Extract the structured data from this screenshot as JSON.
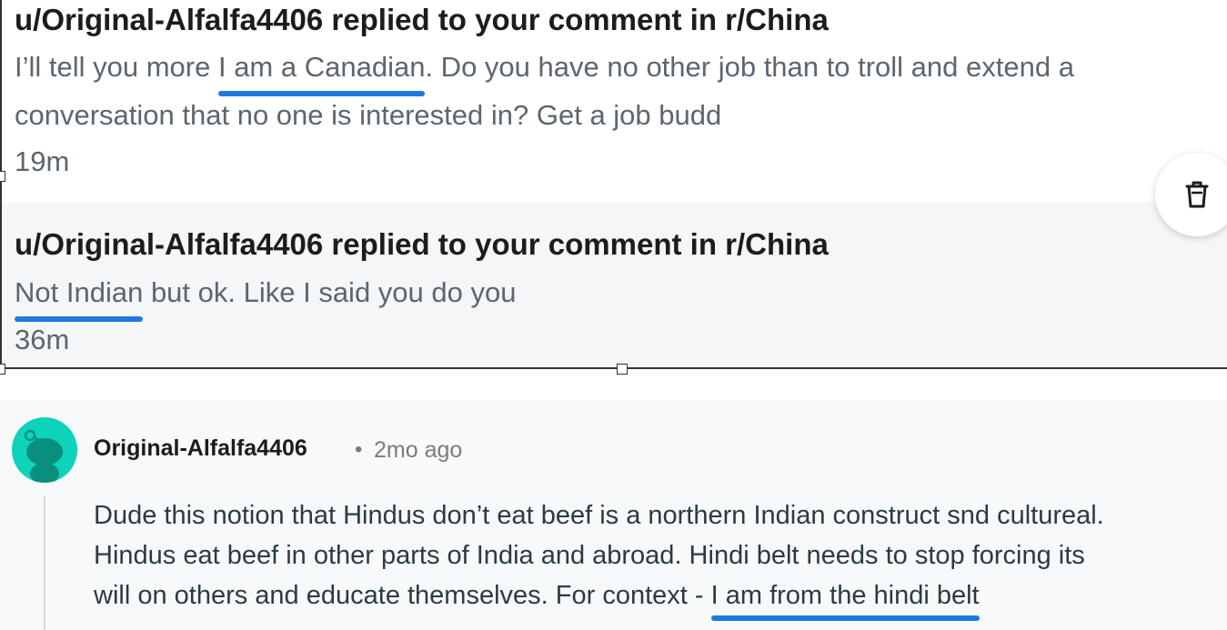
{
  "notifications": [
    {
      "title": "u/Original-Alfalfa4406 replied to your comment in r/China",
      "body_before": "I’ll tell you more ",
      "body_highlight": "I am a Canadian",
      "body_after": ". Do you have no other job than to troll and extend a",
      "body_line2": "conversation that no one is interested in? Get a job budd",
      "time": "19m"
    },
    {
      "title": "u/Original-Alfalfa4406 replied to your comment in r/China",
      "body_highlight": "Not Indian",
      "body_after": " but ok. Like I said you do you",
      "time": "36m"
    }
  ],
  "delete_button": {
    "icon": "trash-icon"
  },
  "comment": {
    "author": "Original-Alfalfa4406",
    "separator": "•",
    "age": "2mo ago",
    "line1": "Dude this notion that Hindus don’t eat beef is a northern Indian construct snd cultureal.",
    "line2": "Hindus eat beef in other parts of India and abroad. Hindi belt needs to stop forcing its",
    "line3_before": "will on others and educate themselves. For context - ",
    "line3_highlight": "I am from the hindi belt"
  },
  "colors": {
    "underline": "#1f7ae0",
    "avatar_bg": "#0dd3bb",
    "muted_text": "#5c6670"
  }
}
